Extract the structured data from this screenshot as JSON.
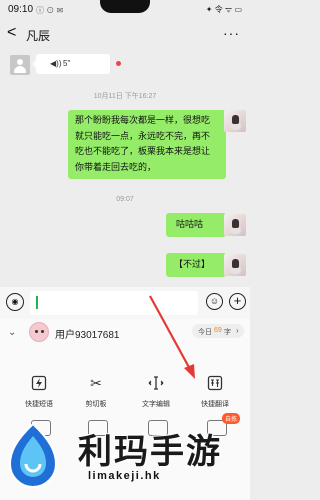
{
  "status": {
    "time": "09:10",
    "icons": "ⓘ ⊙ ✉",
    "right": "✦ 令 ᯤ ▭"
  },
  "header": {
    "back": "<",
    "title": "凡辰",
    "more": "···"
  },
  "messages": {
    "voice": {
      "duration": "5\""
    },
    "time1": "10月11日 下午16:27",
    "msg1": [
      "那个盼盼我每次都是一样，很想吃",
      "就只能吃一点，永远吃不完，再不",
      "吃也不能吃了，板栗我本来是想让",
      "你带着走回去吃的，"
    ],
    "time2": "09:07",
    "msg2": "咕咕咕",
    "msg3": "【不过】"
  },
  "input": {
    "value": ""
  },
  "ime": {
    "username": "用户93017681",
    "quota": {
      "prefix": "今日",
      "count": "69",
      "suffix": "字",
      "arrow": "›"
    },
    "tools": [
      "快捷短语",
      "剪切板",
      "文字编辑",
      "快捷翻译"
    ],
    "badge": "自拣"
  },
  "watermark": {
    "text": "利玛手游",
    "domain": "limakeji.hk"
  },
  "colors": {
    "bubble_me": "#95ec69",
    "arrow": "#e53935",
    "accent": "#f08a1a"
  },
  "icons": {
    "voice": "mic-icon",
    "emoji": "smile-icon",
    "plus": "plus-icon"
  }
}
